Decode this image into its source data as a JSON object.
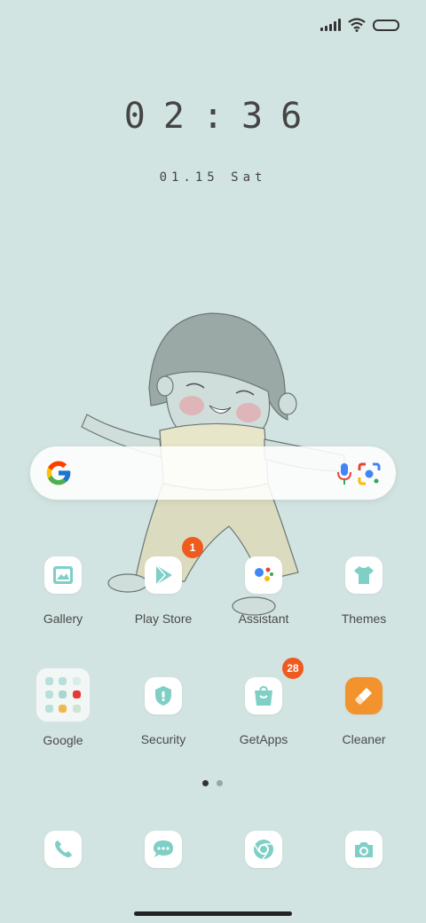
{
  "status": {
    "icons": [
      "signal-icon",
      "wifi-icon",
      "battery-icon"
    ]
  },
  "clock": {
    "time": "02:36",
    "date": "01.15 Sat"
  },
  "search": {
    "icons": [
      "google-g-icon",
      "mic-icon",
      "lens-icon"
    ]
  },
  "apps_row1": [
    {
      "label": "Gallery",
      "icon": "gallery-icon"
    },
    {
      "label": "Play Store",
      "icon": "play-store-icon",
      "badge": "1"
    },
    {
      "label": "Assistant",
      "icon": "assistant-icon"
    },
    {
      "label": "Themes",
      "icon": "themes-icon"
    }
  ],
  "apps_row2": [
    {
      "label": "Google",
      "icon": "folder-icon"
    },
    {
      "label": "Security",
      "icon": "security-icon"
    },
    {
      "label": "GetApps",
      "icon": "getapps-icon",
      "badge": "28"
    },
    {
      "label": "Cleaner",
      "icon": "cleaner-icon"
    }
  ],
  "page_indicator": {
    "count": 2,
    "active": 0
  },
  "dock": [
    "phone-icon",
    "messages-icon",
    "chrome-icon",
    "camera-icon"
  ],
  "colors": {
    "background": "#d2e4e1",
    "accent": "#7fcfc7",
    "badge": "#ef5a1f",
    "cleaner": "#f2932d"
  }
}
